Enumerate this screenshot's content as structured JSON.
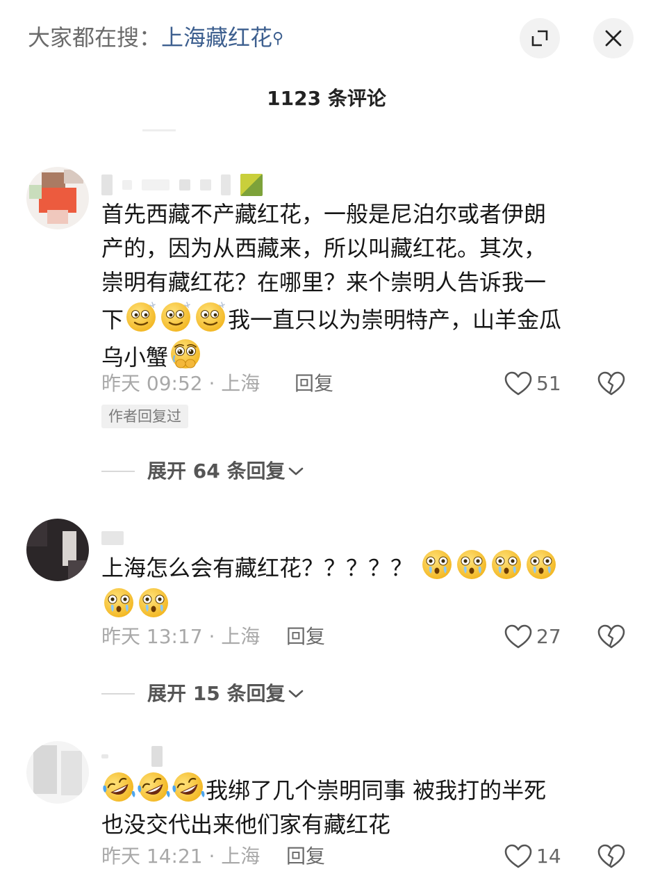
{
  "search": {
    "prefix": "大家都在搜：",
    "query": "上海藏红花",
    "icon": "search-icon"
  },
  "header": {
    "comment_count_title": "1123 条评论",
    "expand_icon": "expand-icon",
    "close_icon": "close-icon"
  },
  "comments": [
    {
      "text_lines": [
        "首先西藏不产藏红花，一般是尼泊尔或者伊朗",
        "产的，因为从西藏来，所以叫藏红花。其次，",
        "崇明有藏红花？在哪里？来个崇明人告诉我一"
      ],
      "line4_prefix": "下",
      "line4_suffix": "我一直只以为崇明特产，山羊金瓜",
      "line5_prefix": "乌小蟹",
      "emoji_line4": "dizzy-face-emoji",
      "emoji_line5": "pleading-face-emoji",
      "time_location": "昨天 09:52 · 上海",
      "reply_label": "回复",
      "likes": "51",
      "author_replied": "作者回复过",
      "expand_replies": "展开 64 条回复"
    },
    {
      "text": "上海怎么会有藏红花？？？？？",
      "emoji": "crying-surprised-emoji",
      "time_location": "昨天 13:17 · 上海",
      "reply_label": "回复",
      "likes": "27",
      "expand_replies": "展开 15 条回复"
    },
    {
      "line1_suffix": "我绑了几个崇明同事 被我打的半死",
      "line2": "也没交代出来他们家有藏红花",
      "emoji": "laughing-tears-emoji",
      "time_location": "昨天 14:21 · 上海",
      "reply_label": "回复",
      "likes": "14"
    }
  ],
  "colors": {
    "accent_link": "#3d5f8f",
    "meta_gray": "#a8a8a8",
    "emoji_yellow": "#f7c531"
  }
}
